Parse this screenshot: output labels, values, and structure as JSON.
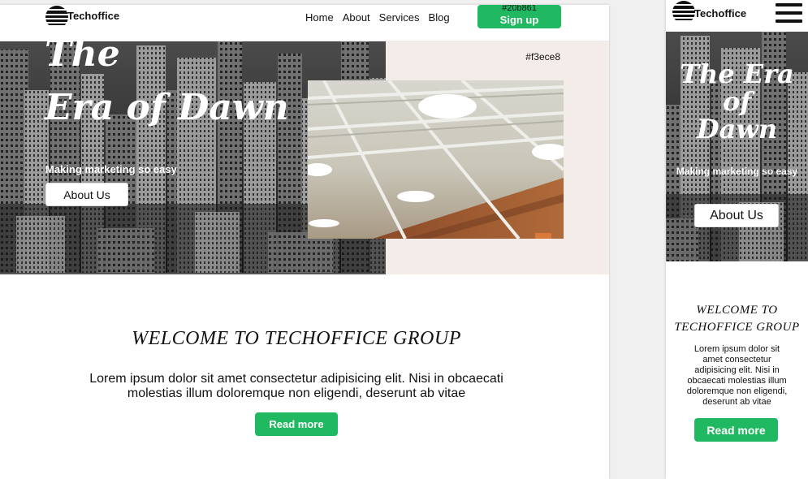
{
  "colors": {
    "accent": "#20b861",
    "panel": "#f3ece8"
  },
  "desktop": {
    "logo_text": "Techoffice",
    "nav": [
      "Home",
      "About",
      "Services",
      "Blog"
    ],
    "signup_code_label": "#20b861",
    "signup_label": "Sign up",
    "hero_panel_label": "#f3ece8",
    "hero_title_line1": "The",
    "hero_title_line2": "Era of Dawn",
    "hero_subtitle": "Making marketing so easy",
    "about_button": "About Us",
    "welcome_title": "WELCOME TO TECHOFFICE GROUP",
    "body_text": "Lorem ipsum dolor sit amet consectetur adipisicing elit. Nisi in obcaecati molestias illum doloremque non eligendi, deserunt ab vitae",
    "read_more": "Read more"
  },
  "mobile": {
    "logo_text": "Techoffice",
    "menu_icon": "hamburger-menu-icon",
    "hero_title_line1": "The Era",
    "hero_title_line2": "of",
    "hero_title_line3": "Dawn",
    "hero_subtitle": "Making marketing so easy",
    "about_button": "About Us",
    "welcome_title": "WELCOME TO TECHOFFICE GROUP",
    "body_text": "Lorem ipsum dolor sit amet consectetur adipisicing elit. Nisi in obcaecati molestias illum doloremque non eligendi, deserunt ab vitae",
    "read_more": "Read more"
  }
}
